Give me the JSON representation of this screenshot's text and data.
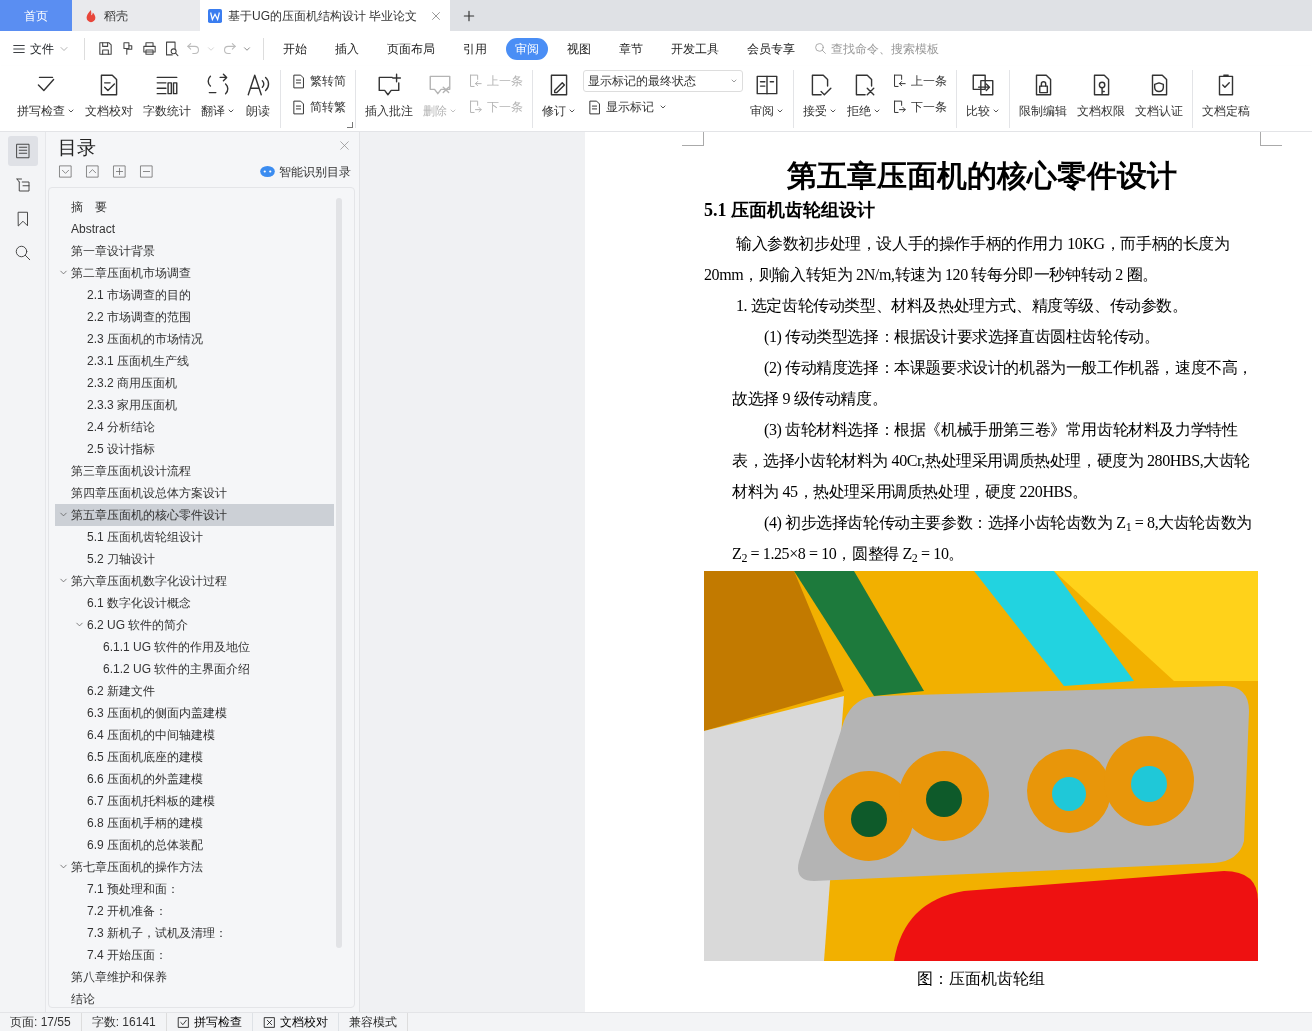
{
  "tabs": [
    {
      "label": "首页",
      "kind": "home",
      "selected": false
    },
    {
      "label": "稻壳",
      "kind": "docer",
      "selected": false
    },
    {
      "label": "基于UG的压面机结构设计 毕业论文",
      "kind": "doc",
      "selected": true
    }
  ],
  "menu": {
    "file": "文件",
    "tabs": [
      {
        "label": "开始",
        "selected": false
      },
      {
        "label": "插入",
        "selected": false
      },
      {
        "label": "页面布局",
        "selected": false
      },
      {
        "label": "引用",
        "selected": false
      },
      {
        "label": "审阅",
        "selected": true
      },
      {
        "label": "视图",
        "selected": false
      },
      {
        "label": "章节",
        "selected": false
      },
      {
        "label": "开发工具",
        "selected": false
      },
      {
        "label": "会员专享",
        "selected": false
      }
    ],
    "search_placeholder": "查找命令、搜索模板"
  },
  "ribbon": [
    [
      {
        "kind": "big",
        "label": "拼写检查",
        "dropdown": true,
        "disabled": false
      },
      {
        "kind": "big",
        "label": "文档校对",
        "dropdown": false,
        "disabled": false
      },
      {
        "kind": "big",
        "label": "字数统计",
        "dropdown": false,
        "disabled": false
      },
      {
        "kind": "big",
        "label": "翻译",
        "dropdown": true,
        "disabled": false
      },
      {
        "kind": "big",
        "label": "朗读",
        "dropdown": false,
        "disabled": false
      }
    ],
    [
      {
        "kind": "stack",
        "items": [
          {
            "label": "繁转简",
            "disabled": false
          },
          {
            "label": "简转繁",
            "disabled": false
          }
        ]
      }
    ],
    [
      {
        "kind": "big",
        "label": "插入批注",
        "dropdown": false,
        "disabled": false
      },
      {
        "kind": "big",
        "label": "删除",
        "dropdown": true,
        "disabled": true
      },
      {
        "kind": "stack",
        "items": [
          {
            "label": "上一条",
            "disabled": true
          },
          {
            "label": "下一条",
            "disabled": true
          }
        ]
      }
    ],
    [
      {
        "kind": "big",
        "label": "修订",
        "dropdown": true,
        "disabled": false
      },
      {
        "kind": "select",
        "value": "显示标记的最终状态",
        "label": "显示标记"
      },
      {
        "kind": "big",
        "label": "审阅",
        "dropdown": true,
        "disabled": false
      }
    ],
    [
      {
        "kind": "big",
        "label": "接受",
        "dropdown": true,
        "disabled": false
      },
      {
        "kind": "big",
        "label": "拒绝",
        "dropdown": true,
        "disabled": false
      },
      {
        "kind": "stack",
        "items": [
          {
            "label": "上一条",
            "disabled": false
          },
          {
            "label": "下一条",
            "disabled": false
          }
        ]
      }
    ],
    [
      {
        "kind": "big",
        "label": "比较",
        "dropdown": true,
        "disabled": false
      }
    ],
    [
      {
        "kind": "big",
        "label": "限制编辑",
        "dropdown": false,
        "disabled": false
      },
      {
        "kind": "big",
        "label": "文档权限",
        "dropdown": false,
        "disabled": false
      },
      {
        "kind": "big",
        "label": "文档认证",
        "dropdown": false,
        "disabled": false
      }
    ],
    [
      {
        "kind": "big",
        "label": "文档定稿",
        "dropdown": false,
        "disabled": false
      }
    ]
  ],
  "rail": [
    {
      "selected": true
    },
    {
      "selected": false
    },
    {
      "selected": false
    },
    {
      "selected": false
    }
  ],
  "toc": {
    "title": "目录",
    "smart": "智能识别目录",
    "items": [
      {
        "label": "摘　要",
        "selected": false
      },
      {
        "label": "Abstract",
        "selected": false
      },
      {
        "label": "第一章设计背景",
        "selected": false
      },
      {
        "label": "第二章压面机市场调查",
        "selected": false,
        "expanded": true,
        "children": [
          {
            "label": "2.1 市场调查的目的",
            "selected": false
          },
          {
            "label": "2.2 市场调查的范围",
            "selected": false
          },
          {
            "label": "2.3 压面机的市场情况",
            "selected": false
          },
          {
            "label": "2.3.1 压面机生产线",
            "selected": false
          },
          {
            "label": "2.3.2 商用压面机",
            "selected": false
          },
          {
            "label": "2.3.3 家用压面机",
            "selected": false
          },
          {
            "label": "2.4 分析结论",
            "selected": false
          },
          {
            "label": "2.5 设计指标",
            "selected": false
          }
        ]
      },
      {
        "label": "第三章压面机设计流程",
        "selected": false
      },
      {
        "label": "第四章压面机设总体方案设计",
        "selected": false
      },
      {
        "label": "第五章压面机的核心零件设计",
        "selected": true,
        "expanded": true,
        "children": [
          {
            "label": "5.1 压面机齿轮组设计",
            "selected": false
          },
          {
            "label": "5.2 刀轴设计",
            "selected": false
          }
        ]
      },
      {
        "label": "第六章压面机数字化设计过程",
        "selected": false,
        "expanded": true,
        "children": [
          {
            "label": "6.1 数字化设计概念",
            "selected": false
          },
          {
            "label": "6.2 UG 软件的简介",
            "selected": false,
            "expanded": true,
            "children": [
              {
                "label": "6.1.1 UG 软件的作用及地位",
                "selected": false
              },
              {
                "label": "6.1.2 UG 软件的主界面介绍",
                "selected": false
              }
            ]
          },
          {
            "label": "6.2  新建文件",
            "selected": false
          },
          {
            "label": "6.3  压面机的侧面内盖建模",
            "selected": false
          },
          {
            "label": "6.4 压面机的中间轴建模",
            "selected": false
          },
          {
            "label": "6.5  压面机底座的建模",
            "selected": false
          },
          {
            "label": "6.6  压面机的外盖建模",
            "selected": false
          },
          {
            "label": "6.7  压面机托料板的建模",
            "selected": false
          },
          {
            "label": "6.8 压面机手柄的建模",
            "selected": false
          },
          {
            "label": "6.9 压面机的总体装配",
            "selected": false
          }
        ]
      },
      {
        "label": "第七章压面机的操作方法",
        "selected": false,
        "expanded": true,
        "children": [
          {
            "label": "7.1 预处理和面：",
            "selected": false
          },
          {
            "label": "7.2 开机准备：",
            "selected": false
          },
          {
            "label": "7.3 新机子，试机及清理：",
            "selected": false
          },
          {
            "label": "7.4 开始压面：",
            "selected": false
          }
        ]
      },
      {
        "label": "第八章维护和保养",
        "selected": false
      },
      {
        "label": "结论",
        "selected": false
      }
    ]
  },
  "document": {
    "title": "第五章压面机的核心零件设计",
    "heading": "5.1 压面机齿轮组设计",
    "paragraphs": [
      {
        "kind": "body",
        "text": "输入参数初步处理，设人手的操作手柄的作用力 10KG，而手柄的长度为 20mm，则输入转矩为 2N/m,转速为 120 转每分即一秒钟转动 2 圈。"
      },
      {
        "kind": "list",
        "text": "1.  选定齿轮传动类型、材料及热处理方式、精度等级、传动参数。"
      },
      {
        "kind": "sub",
        "text": "(1) 传动类型选择：根据设计要求选择直齿圆柱齿轮传动。"
      },
      {
        "kind": "sub",
        "text": "(2) 传动精度选择：本课题要求设计的机器为一般工作机器，速度不高，故选择 9 级传动精度。"
      },
      {
        "kind": "sub",
        "text": "(3) 齿轮材料选择：根据《机械手册第三卷》常用齿轮材料及力学特性表，选择小齿轮材料为 40Cr,热处理采用调质热处理，硬度为 280HBS,大齿轮材料为 45，热处理采用调质热处理，硬度 220HBS。"
      },
      {
        "kind": "sub",
        "text": "(4) 初步选择齿轮传动主要参数：选择小齿轮齿数为 Z$_{1}$ = 8,大齿轮齿数为 Z$_{2}$ = 1.25×8 = 10，圆整得 Z$_{2}$ = 10。"
      }
    ],
    "figure": {
      "kind": "picture",
      "caption": "图：压面机齿轮组"
    }
  },
  "status_bar": [
    {
      "kind": "text",
      "label": "页面: 17/55"
    },
    {
      "kind": "text",
      "label": "字数: 16141"
    },
    {
      "kind": "check",
      "label": "拼写检查"
    },
    {
      "kind": "cross",
      "label": "文档校对"
    },
    {
      "kind": "text",
      "label": "兼容模式"
    }
  ]
}
